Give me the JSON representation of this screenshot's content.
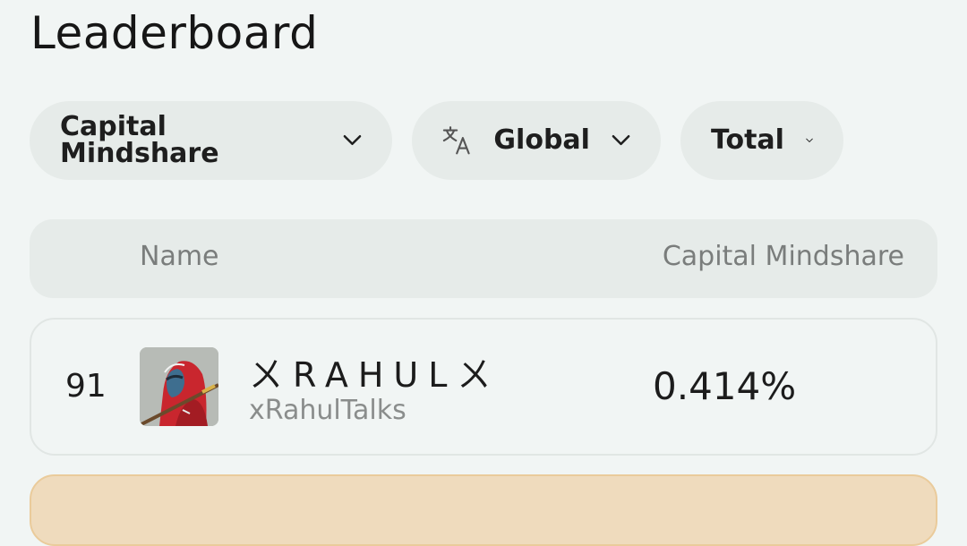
{
  "header": {
    "title": "Leaderboard"
  },
  "filters": {
    "metric": {
      "label": "Capital Mindshare",
      "icon": "chevron-down-icon"
    },
    "region": {
      "label": "Global",
      "icon": "translate-icon"
    },
    "period": {
      "label": "Total",
      "icon": "chevron-down-icon"
    }
  },
  "table": {
    "columns": {
      "name": "Name",
      "metric": "Capital Mindshare"
    },
    "rows": [
      {
        "rank": "91",
        "display_name": "ㄨRAHULㄨ",
        "handle": "xRahulTalks",
        "value": "0.414%"
      }
    ]
  },
  "colors": {
    "background": "#f1f5f4",
    "pill": "#e6ebe9",
    "highlight_row": "#efdbbd"
  }
}
